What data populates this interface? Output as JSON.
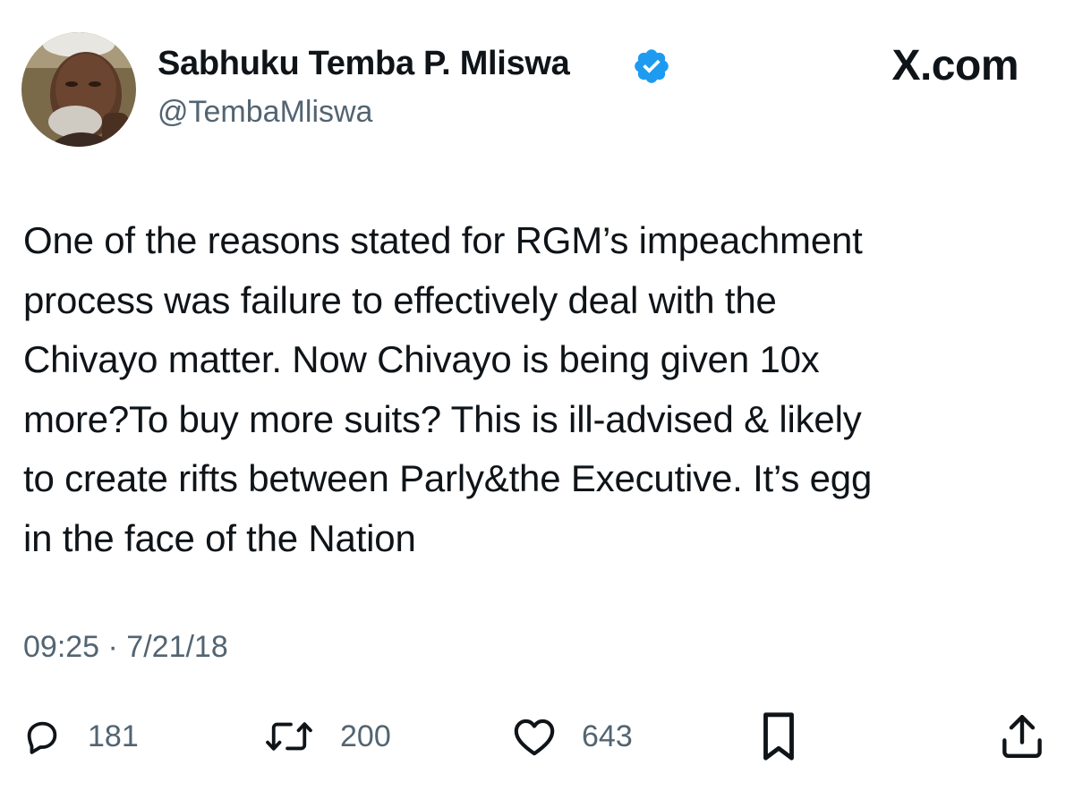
{
  "author": {
    "display_name": "Sabhuku Temba P. Mliswa",
    "handle": "@TembaMliswa",
    "verified": true,
    "avatar_icon": "profile-photo"
  },
  "site_label": "X.com",
  "tweet": {
    "text": "One of the reasons stated for RGM’s impeachment\nprocess was failure to effectively deal with the\nChivayo matter. Now Chivayo is being given 10x\nmore?To buy more suits? This is ill-advised & likely\nto create rifts between Parly&the Executive. It’s egg\nin the face of the Nation",
    "timestamp": "09:25 · 7/21/18"
  },
  "actions": {
    "replies": {
      "icon": "reply-icon",
      "count": "181"
    },
    "retweets": {
      "icon": "retweet-icon",
      "count": "200"
    },
    "likes": {
      "icon": "heart-icon",
      "count": "643"
    },
    "bookmark": {
      "icon": "bookmark-icon"
    },
    "share": {
      "icon": "share-icon"
    }
  },
  "colors": {
    "text": "#0f1419",
    "secondary": "#536471",
    "verified_badge": "#1d9bf0"
  }
}
